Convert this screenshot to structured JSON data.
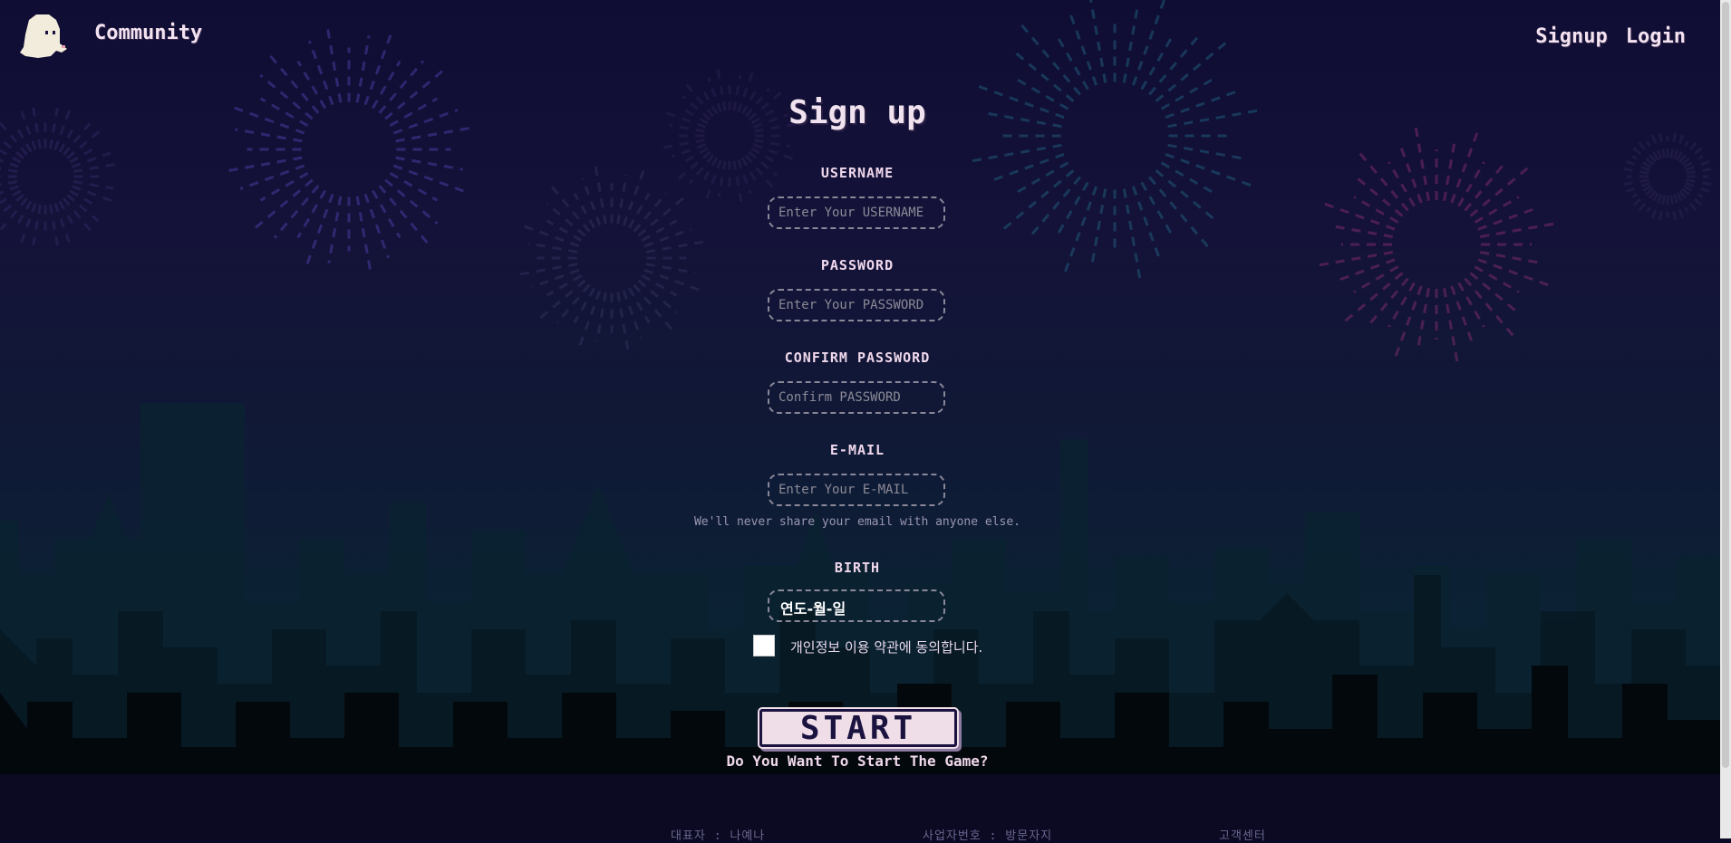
{
  "nav": {
    "brand": "Community",
    "links": [
      "Signup",
      "Login"
    ]
  },
  "form": {
    "title": "Sign up",
    "fields": [
      {
        "label": "USERNAME",
        "placeholder": "Enter Your USERNAME",
        "value": ""
      },
      {
        "label": "PASSWORD",
        "placeholder": "Enter Your PASSWORD",
        "value": ""
      },
      {
        "label": "CONFIRM PASSWORD",
        "placeholder": "Confirm PASSWORD",
        "value": ""
      },
      {
        "label": "E-MAIL",
        "placeholder": "Enter Your E-MAIL",
        "value": ""
      }
    ],
    "email_hint": "We'll never share your email with anyone else.",
    "birth": {
      "label": "BIRTH",
      "value": "연도-월-일"
    },
    "agree": {
      "label": "개인정보 이용 약관에 동의합니다.",
      "checked": false
    },
    "start_button": "START",
    "start_question": "Do You Want To Start The Game?"
  },
  "footer": {
    "items": [
      "대표자 : 나예나",
      "사업자번호 : 방문자지",
      "고객센터"
    ]
  },
  "colors": {
    "sky_top": "#0f0d33",
    "sky_bottom": "#082030",
    "text": "#f0d8ec",
    "button_bg": "#efdde8",
    "button_text": "#1a1340"
  }
}
